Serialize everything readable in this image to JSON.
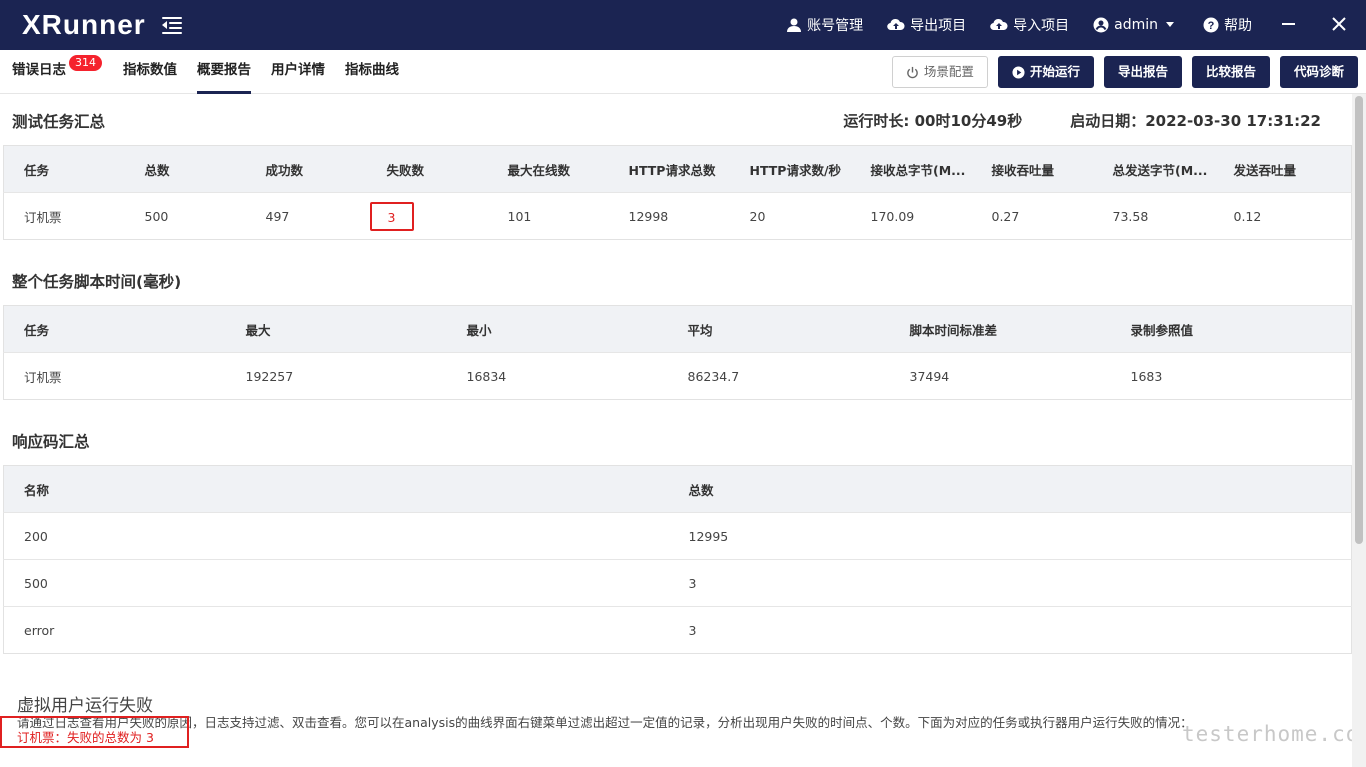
{
  "app": {
    "logo_text": "XRunner"
  },
  "topbar": {
    "items": [
      {
        "label": "账号管理",
        "icon": "user-icon"
      },
      {
        "label": "导出项目",
        "icon": "cloud-upload-icon"
      },
      {
        "label": "导入项目",
        "icon": "cloud-download-icon"
      },
      {
        "label": "admin",
        "icon": "account-circle-icon"
      },
      {
        "label": "帮助",
        "icon": "help-circle-icon"
      }
    ],
    "minimize_icon": "minimize-icon",
    "close_icon": "close-icon"
  },
  "tabs": [
    {
      "label": "错误日志",
      "badge": "314"
    },
    {
      "label": "指标数值"
    },
    {
      "label": "概要报告",
      "active": true
    },
    {
      "label": "用户详情"
    },
    {
      "label": "指标曲线"
    }
  ],
  "toolbar": {
    "scene_config": "场景配置",
    "start_run": "开始运行",
    "export_report": "导出报告",
    "compare_report": "比较报告",
    "code_diagnose": "代码诊断"
  },
  "summary": {
    "title": "测试任务汇总",
    "duration": "运行时长: 00时10分49秒",
    "start_date": "启动日期：2022-03-30 17:31:22",
    "headers": [
      "任务",
      "总数",
      "成功数",
      "失败数",
      "最大在线数",
      "HTTP请求总数",
      "HTTP请求数/秒",
      "接收总字节(M...",
      "接收吞吐量",
      "总发送字节(M...",
      "发送吞吐量"
    ],
    "rows": [
      [
        "订机票",
        "500",
        "497",
        "3",
        "101",
        "12998",
        "20",
        "170.09",
        "0.27",
        "73.58",
        "0.12"
      ]
    ]
  },
  "script_time": {
    "title": "整个任务脚本时间(毫秒)",
    "headers": [
      "任务",
      "最大",
      "最小",
      "平均",
      "脚本时间标准差",
      "录制参照值"
    ],
    "rows": [
      [
        "订机票",
        "192257",
        "16834",
        "86234.7",
        "37494",
        "1683"
      ]
    ]
  },
  "response_codes": {
    "title": "响应码汇总",
    "headers": [
      "名称",
      "总数"
    ],
    "rows": [
      [
        "200",
        "12995"
      ],
      [
        "500",
        "3"
      ],
      [
        "error",
        "3"
      ]
    ]
  },
  "vu_failure": {
    "title": "虚拟用户运行失败",
    "description": "请通过日志查看用户失败的原因，日志支持过滤、双击查看。您可以在analysis的曲线界面右键菜单过滤出超过一定值的记录，分析出现用户失败的时间点、个数。下面为对应的任务或执行器用户运行失败的情况：",
    "fail_line": "订机票：失败的总数为 3"
  },
  "watermark": "testerhome.com",
  "colors": {
    "topbar_bg": "#1b2452",
    "highlight_red": "#e02020",
    "badge_red": "#f5222d"
  }
}
